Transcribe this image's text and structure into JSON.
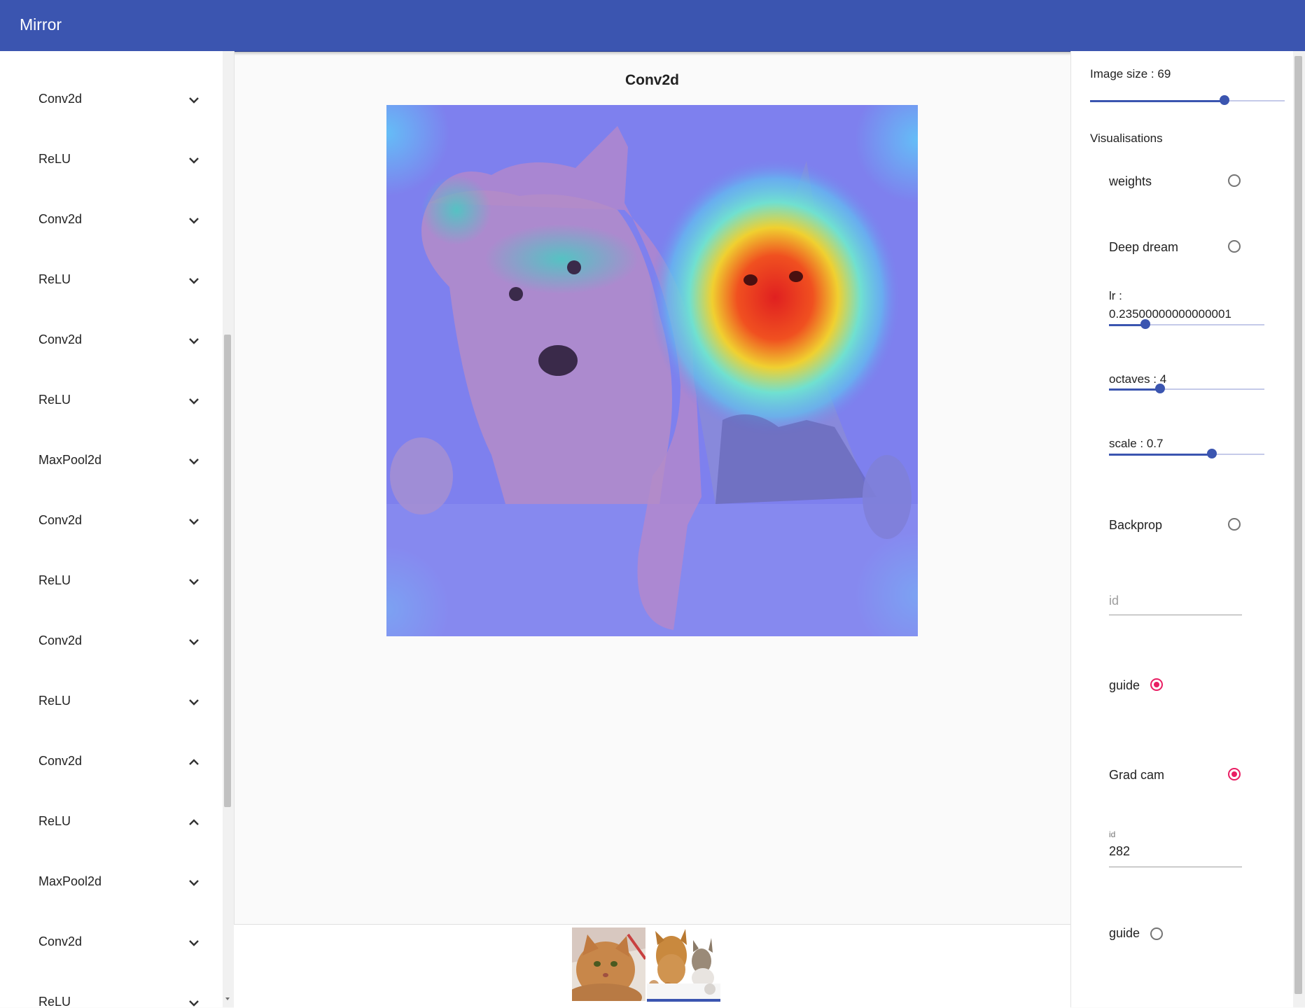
{
  "app": {
    "title": "Mirror"
  },
  "sidebar": {
    "layers": [
      {
        "label": "Conv2d",
        "expanded": false
      },
      {
        "label": "ReLU",
        "expanded": false
      },
      {
        "label": "Conv2d",
        "expanded": false
      },
      {
        "label": "ReLU",
        "expanded": false
      },
      {
        "label": "Conv2d",
        "expanded": false
      },
      {
        "label": "ReLU",
        "expanded": false
      },
      {
        "label": "MaxPool2d",
        "expanded": false
      },
      {
        "label": "Conv2d",
        "expanded": false
      },
      {
        "label": "ReLU",
        "expanded": false
      },
      {
        "label": "Conv2d",
        "expanded": false
      },
      {
        "label": "ReLU",
        "expanded": false
      },
      {
        "label": "Conv2d",
        "expanded": true
      },
      {
        "label": "ReLU",
        "expanded": true
      },
      {
        "label": "MaxPool2d",
        "expanded": false
      },
      {
        "label": "Conv2d",
        "expanded": false
      },
      {
        "label": "ReLU",
        "expanded": false
      }
    ]
  },
  "main": {
    "title": "Conv2d"
  },
  "settings": {
    "image_size_label": "Image size : 69",
    "image_size_fraction": 0.69,
    "visualisations_label": "Visualisations",
    "weights_label": "weights",
    "weights_selected": false,
    "deep_dream_label": "Deep dream",
    "deep_dream_selected": false,
    "lr_label": "lr :",
    "lr_value": "0.23500000000000001",
    "lr_fraction": 0.235,
    "octaves_label": "octaves : 4",
    "octaves_fraction": 0.33,
    "scale_label": "scale : 0.7",
    "scale_fraction": 0.66,
    "backprop_label": "Backprop",
    "backprop_selected": false,
    "backprop_id_placeholder": "id",
    "backprop_guide_label": "guide",
    "backprop_guide_selected": true,
    "gradcam_label": "Grad cam",
    "gradcam_selected": true,
    "gradcam_id_label": "id",
    "gradcam_id_value": "282",
    "gradcam_guide_label": "guide",
    "gradcam_guide_selected": false
  },
  "thumbnails": [
    {
      "subject": "cat",
      "selected": false
    },
    {
      "subject": "dog-and-cat",
      "selected": true
    }
  ],
  "colors": {
    "primary": "#3b55b0",
    "accent": "#e91e63"
  }
}
